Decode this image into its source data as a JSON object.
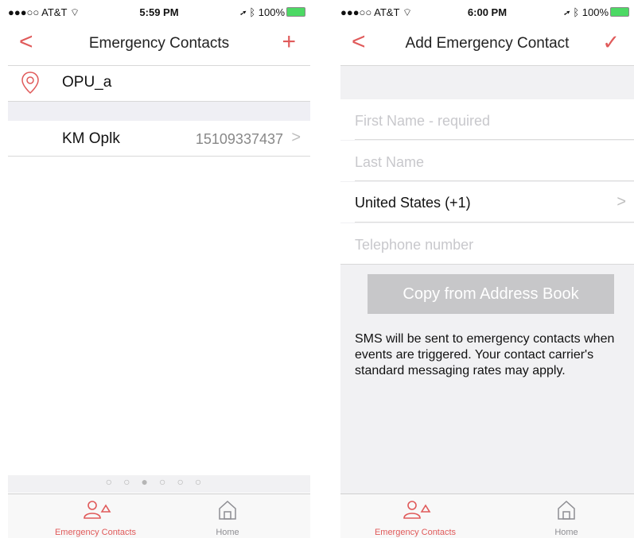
{
  "left_screen": {
    "status": {
      "signal": "●●●○○ AT&T",
      "time": "5:59 PM",
      "battery": "100%"
    },
    "nav": {
      "back": "<",
      "title": "Emergency Contacts",
      "add": "+"
    },
    "location_label": "OPU_a",
    "contact": {
      "name": "KM Oplk",
      "phone": "15109337437"
    },
    "page_dots": "○○●○○○",
    "tabs": [
      {
        "label": "Emergency Contacts",
        "icon": "emergency-contacts-icon",
        "active": true
      },
      {
        "label": "Home",
        "icon": "home-icon",
        "active": false
      }
    ]
  },
  "right_screen": {
    "status": {
      "signal": "●●●○○ AT&T",
      "time": "6:00 PM",
      "battery": "100%"
    },
    "nav": {
      "back": "<",
      "title": "Add Emergency Contact",
      "confirm": "✓"
    },
    "form": {
      "first_name_placeholder": "First Name - required",
      "last_name_placeholder": "Last Name",
      "country_value": "United States (+1)",
      "telephone_placeholder": "Telephone number"
    },
    "copy_button": "Copy from Address Book",
    "note": "SMS will be sent to emergency contacts when events are triggered. Your contact carrier's standard messaging rates may apply.",
    "tabs": [
      {
        "label": "Emergency Contacts",
        "icon": "emergency-contacts-icon",
        "active": true
      },
      {
        "label": "Home",
        "icon": "home-icon",
        "active": false
      }
    ]
  },
  "colors": {
    "accent": "#e05a5a",
    "tab_inactive": "#8e8e93",
    "placeholder": "#c8c8cc"
  }
}
